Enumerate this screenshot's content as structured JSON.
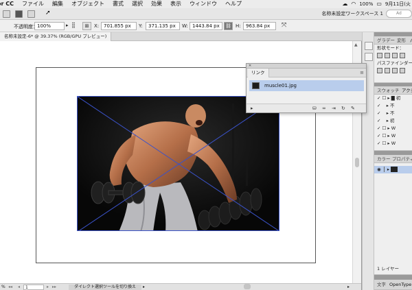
{
  "menubar": {
    "app": "or CC",
    "items": [
      "ファイル",
      "編集",
      "オブジェクト",
      "書式",
      "選択",
      "効果",
      "表示",
      "ウィンドウ",
      "ヘルプ"
    ],
    "battery": "100%",
    "clock": "9月11日(火"
  },
  "appbar": {
    "workspace": "名称未設定ワークスペース 1",
    "search_placeholder": "Ad"
  },
  "control": {
    "opacity_label": "不透明度：",
    "opacity_value": "100%",
    "x_label": "X:",
    "x_value": "701.855 px",
    "y_label": "Y:",
    "y_value": "371.135 px",
    "w_label": "W:",
    "w_value": "1443.84 px",
    "h_label": "H:",
    "h_value": "963.84 px"
  },
  "document": {
    "tab_title": "名称未設定-6* @ 39.37% (RGB/GPU プレビュー)"
  },
  "status": {
    "zoom": "%",
    "page": "1",
    "tool_hint": "ダイレクト選択ツールを切り換え"
  },
  "links_panel": {
    "title": "リンク",
    "items": [
      {
        "name": "muscle01.jpg"
      }
    ]
  },
  "panels": {
    "top_tabs": [
      "グラデー",
      "変形",
      "パ"
    ],
    "shape_mode_label": "形状モード：",
    "pathfinder_label": "パスファインダー：",
    "swatch_tabs": [
      "スウォッチ",
      "アクシ"
    ],
    "actions": [
      "初",
      "不",
      "不",
      "初",
      "W",
      "W",
      "W"
    ],
    "color_tabs": [
      "カラー",
      "プロパティ"
    ],
    "layers_count": "1 レイヤー",
    "bottom_tabs": [
      "文字",
      "OpenType"
    ]
  },
  "colors": {
    "selection": "#3a52c8",
    "link_highlight": "#b9cdec"
  }
}
